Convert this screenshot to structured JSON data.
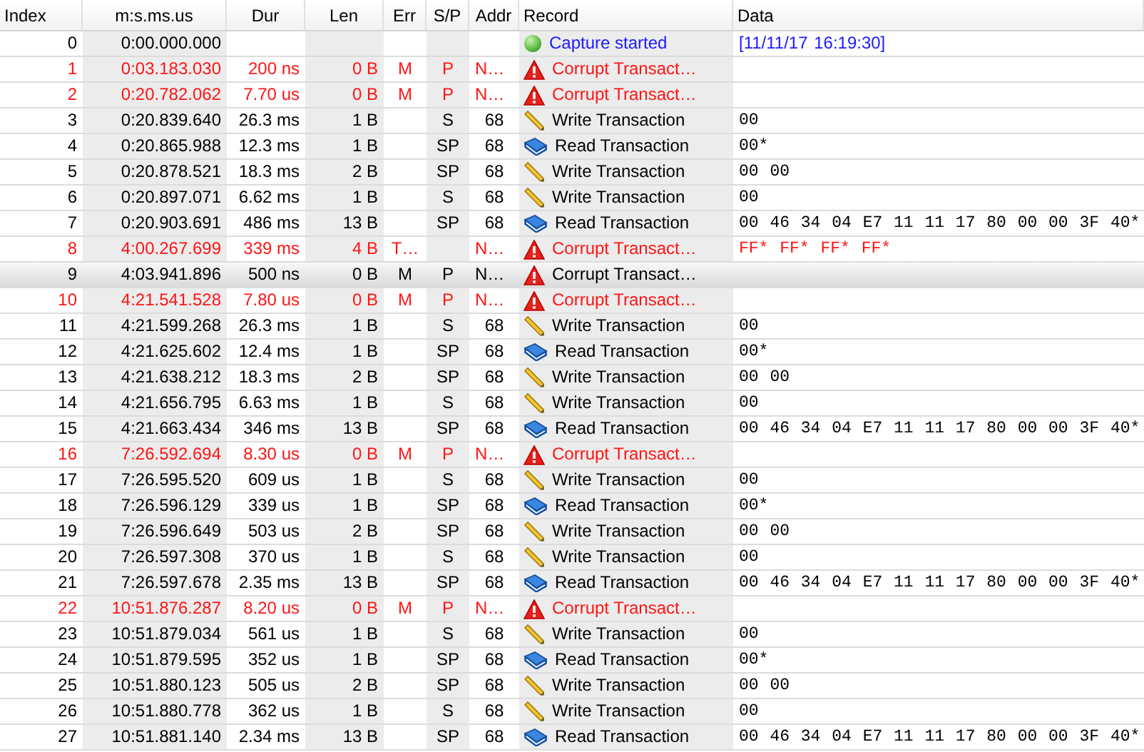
{
  "table": {
    "columns": [
      "Index",
      "m:s.ms.us",
      "Dur",
      "Len",
      "Err",
      "S/P",
      "Addr",
      "Record",
      "Data"
    ],
    "rows": [
      {
        "index": "0",
        "time": "0:00.000.000",
        "kind": "start",
        "record": "Capture started",
        "data": "[11/11/17 16:19:30]",
        "selected": false
      },
      {
        "index": "1",
        "time": "0:03.183.030",
        "dur": "200 ns",
        "len": "0 B",
        "err": "M",
        "sp": "P",
        "addr": "N…",
        "kind": "error",
        "record": "Corrupt Transact…",
        "selected": false
      },
      {
        "index": "2",
        "time": "0:20.782.062",
        "dur": "7.70 us",
        "len": "0 B",
        "err": "M",
        "sp": "P",
        "addr": "N…",
        "kind": "error",
        "record": "Corrupt Transact…",
        "selected": false
      },
      {
        "index": "3",
        "time": "0:20.839.640",
        "dur": "26.3 ms",
        "len": "1 B",
        "sp": "S",
        "addr": "68",
        "kind": "write",
        "record": "Write Transaction",
        "data": "00",
        "selected": false
      },
      {
        "index": "4",
        "time": "0:20.865.988",
        "dur": "12.3 ms",
        "len": "1 B",
        "sp": "SP",
        "addr": "68",
        "kind": "read",
        "record": "Read Transaction",
        "data": "00*",
        "selected": false
      },
      {
        "index": "5",
        "time": "0:20.878.521",
        "dur": "18.3 ms",
        "len": "2 B",
        "sp": "SP",
        "addr": "68",
        "kind": "write",
        "record": "Write Transaction",
        "data": "00 00",
        "selected": false
      },
      {
        "index": "6",
        "time": "0:20.897.071",
        "dur": "6.62 ms",
        "len": "1 B",
        "sp": "S",
        "addr": "68",
        "kind": "write",
        "record": "Write Transaction",
        "data": "00",
        "selected": false
      },
      {
        "index": "7",
        "time": "0:20.903.691",
        "dur": "486 ms",
        "len": "13 B",
        "sp": "SP",
        "addr": "68",
        "kind": "read",
        "record": "Read Transaction",
        "data": "00 46 34 04 E7 11 11 17 80 00 00 3F 40*",
        "selected": false
      },
      {
        "index": "8",
        "time": "4:00.267.699",
        "dur": "339 ms",
        "len": "4 B",
        "err": "T…",
        "addr": "N…",
        "kind": "error",
        "record": "Corrupt Transact…",
        "data": "FF* FF* FF* FF*",
        "selected": false
      },
      {
        "index": "9",
        "time": "4:03.941.896",
        "dur": "500 ns",
        "len": "0 B",
        "err": "M",
        "sp": "P",
        "addr": "N…",
        "kind": "error",
        "record": "Corrupt Transact…",
        "selected": true
      },
      {
        "index": "10",
        "time": "4:21.541.528",
        "dur": "7.80 us",
        "len": "0 B",
        "err": "M",
        "sp": "P",
        "addr": "N…",
        "kind": "error",
        "record": "Corrupt Transact…",
        "selected": false
      },
      {
        "index": "11",
        "time": "4:21.599.268",
        "dur": "26.3 ms",
        "len": "1 B",
        "sp": "S",
        "addr": "68",
        "kind": "write",
        "record": "Write Transaction",
        "data": "00",
        "selected": false
      },
      {
        "index": "12",
        "time": "4:21.625.602",
        "dur": "12.4 ms",
        "len": "1 B",
        "sp": "SP",
        "addr": "68",
        "kind": "read",
        "record": "Read Transaction",
        "data": "00*",
        "selected": false
      },
      {
        "index": "13",
        "time": "4:21.638.212",
        "dur": "18.3 ms",
        "len": "2 B",
        "sp": "SP",
        "addr": "68",
        "kind": "write",
        "record": "Write Transaction",
        "data": "00 00",
        "selected": false
      },
      {
        "index": "14",
        "time": "4:21.656.795",
        "dur": "6.63 ms",
        "len": "1 B",
        "sp": "S",
        "addr": "68",
        "kind": "write",
        "record": "Write Transaction",
        "data": "00",
        "selected": false
      },
      {
        "index": "15",
        "time": "4:21.663.434",
        "dur": "346 ms",
        "len": "13 B",
        "sp": "SP",
        "addr": "68",
        "kind": "read",
        "record": "Read Transaction",
        "data": "00 46 34 04 E7 11 11 17 80 00 00 3F 40*",
        "selected": false
      },
      {
        "index": "16",
        "time": "7:26.592.694",
        "dur": "8.30 us",
        "len": "0 B",
        "err": "M",
        "sp": "P",
        "addr": "N…",
        "kind": "error",
        "record": "Corrupt Transact…",
        "selected": false
      },
      {
        "index": "17",
        "time": "7:26.595.520",
        "dur": "609 us",
        "len": "1 B",
        "sp": "S",
        "addr": "68",
        "kind": "write",
        "record": "Write Transaction",
        "data": "00",
        "selected": false
      },
      {
        "index": "18",
        "time": "7:26.596.129",
        "dur": "339 us",
        "len": "1 B",
        "sp": "SP",
        "addr": "68",
        "kind": "read",
        "record": "Read Transaction",
        "data": "00*",
        "selected": false
      },
      {
        "index": "19",
        "time": "7:26.596.649",
        "dur": "503 us",
        "len": "2 B",
        "sp": "SP",
        "addr": "68",
        "kind": "write",
        "record": "Write Transaction",
        "data": "00 00",
        "selected": false
      },
      {
        "index": "20",
        "time": "7:26.597.308",
        "dur": "370 us",
        "len": "1 B",
        "sp": "S",
        "addr": "68",
        "kind": "write",
        "record": "Write Transaction",
        "data": "00",
        "selected": false
      },
      {
        "index": "21",
        "time": "7:26.597.678",
        "dur": "2.35 ms",
        "len": "13 B",
        "sp": "SP",
        "addr": "68",
        "kind": "read",
        "record": "Read Transaction",
        "data": "00 46 34 04 E7 11 11 17 80 00 00 3F 40*",
        "selected": false
      },
      {
        "index": "22",
        "time": "10:51.876.287",
        "dur": "8.20 us",
        "len": "0 B",
        "err": "M",
        "sp": "P",
        "addr": "N…",
        "kind": "error",
        "record": "Corrupt Transact…",
        "selected": false
      },
      {
        "index": "23",
        "time": "10:51.879.034",
        "dur": "561 us",
        "len": "1 B",
        "sp": "S",
        "addr": "68",
        "kind": "write",
        "record": "Write Transaction",
        "data": "00",
        "selected": false
      },
      {
        "index": "24",
        "time": "10:51.879.595",
        "dur": "352 us",
        "len": "1 B",
        "sp": "SP",
        "addr": "68",
        "kind": "read",
        "record": "Read Transaction",
        "data": "00*",
        "selected": false
      },
      {
        "index": "25",
        "time": "10:51.880.123",
        "dur": "505 us",
        "len": "2 B",
        "sp": "SP",
        "addr": "68",
        "kind": "write",
        "record": "Write Transaction",
        "data": "00 00",
        "selected": false
      },
      {
        "index": "26",
        "time": "10:51.880.778",
        "dur": "362 us",
        "len": "1 B",
        "sp": "S",
        "addr": "68",
        "kind": "write",
        "record": "Write Transaction",
        "data": "00",
        "selected": false
      },
      {
        "index": "27",
        "time": "10:51.881.140",
        "dur": "2.34 ms",
        "len": "13 B",
        "sp": "SP",
        "addr": "68",
        "kind": "read",
        "record": "Read Transaction",
        "data": "00 46 34 04 E7 11 11 17 80 00 00 3F 40*",
        "selected": false
      }
    ]
  }
}
